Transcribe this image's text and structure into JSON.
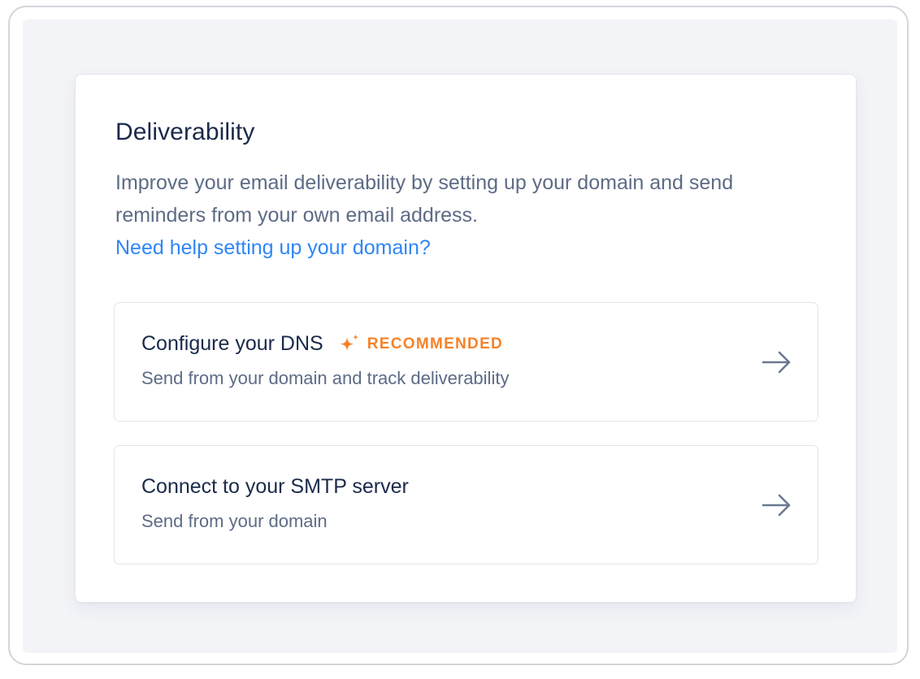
{
  "card": {
    "title": "Deliverability",
    "description": "Improve your email deliverability by setting up your domain and send reminders from your own email address.",
    "help_link": "Need help setting up your domain?"
  },
  "options": [
    {
      "title": "Configure your DNS",
      "badge": "RECOMMENDED",
      "badge_icon": "sparkle-icon",
      "subtitle": "Send from your domain and track deliverability",
      "action_icon": "arrow-right-icon"
    },
    {
      "title": "Connect to your SMTP server",
      "subtitle": "Send from your domain",
      "action_icon": "arrow-right-icon"
    }
  ],
  "colors": {
    "title": "#1b2a4a",
    "body_text": "#5d6b85",
    "link": "#2f86f6",
    "badge": "#f5822a",
    "backdrop": "#f3f4f8",
    "arrow": "#6b7891"
  }
}
